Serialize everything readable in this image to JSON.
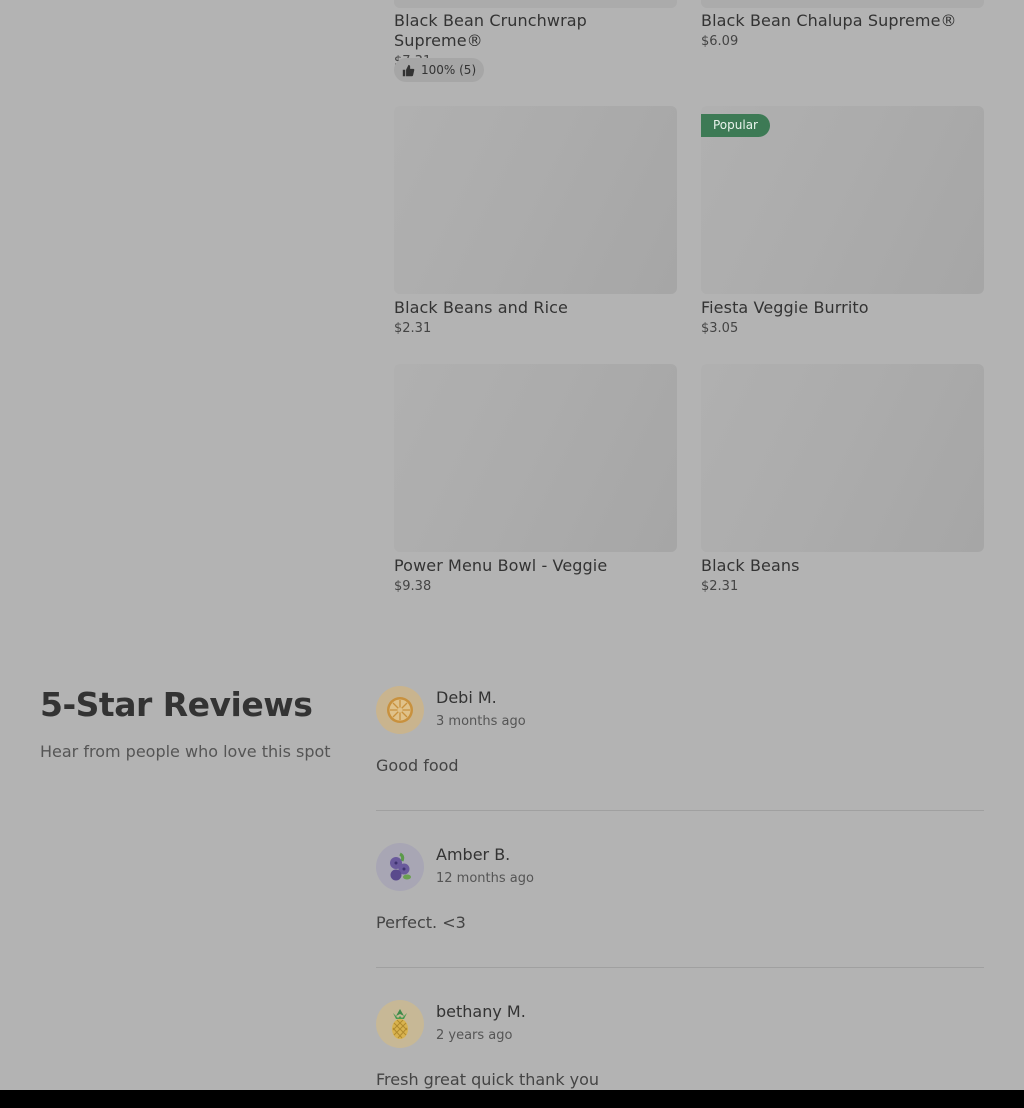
{
  "menu_items": [
    {
      "name": "Black Bean Crunchwrap Supreme®",
      "price": "$7.31",
      "rating": "100% (5)"
    },
    {
      "name": "Black Bean Chalupa Supreme®",
      "price": "$6.09"
    },
    {
      "name": "Black Beans and Rice",
      "price": "$2.31"
    },
    {
      "name": "Fiesta Veggie Burrito",
      "price": "$3.05",
      "badge": "Popular"
    },
    {
      "name": "Power Menu Bowl - Veggie",
      "price": "$9.38"
    },
    {
      "name": "Black Beans",
      "price": "$2.31"
    }
  ],
  "reviews_section": {
    "title": "5-Star Reviews",
    "subtitle": "Hear from people who love this spot"
  },
  "reviews": [
    {
      "name": "Debi M.",
      "time": "3 months ago",
      "text": "Good food",
      "avatar_icon": "orange-slice-icon"
    },
    {
      "name": "Amber B.",
      "time": "12 months ago",
      "text": "Perfect. <3",
      "avatar_icon": "blueberries-icon"
    },
    {
      "name": "bethany M.",
      "time": "2 years ago",
      "text": "Fresh great quick thank you",
      "avatar_icon": "pineapple-icon"
    }
  ],
  "colors": {
    "overlay_bg": "#b3b3b3",
    "badge_green": "#3d7a55"
  }
}
